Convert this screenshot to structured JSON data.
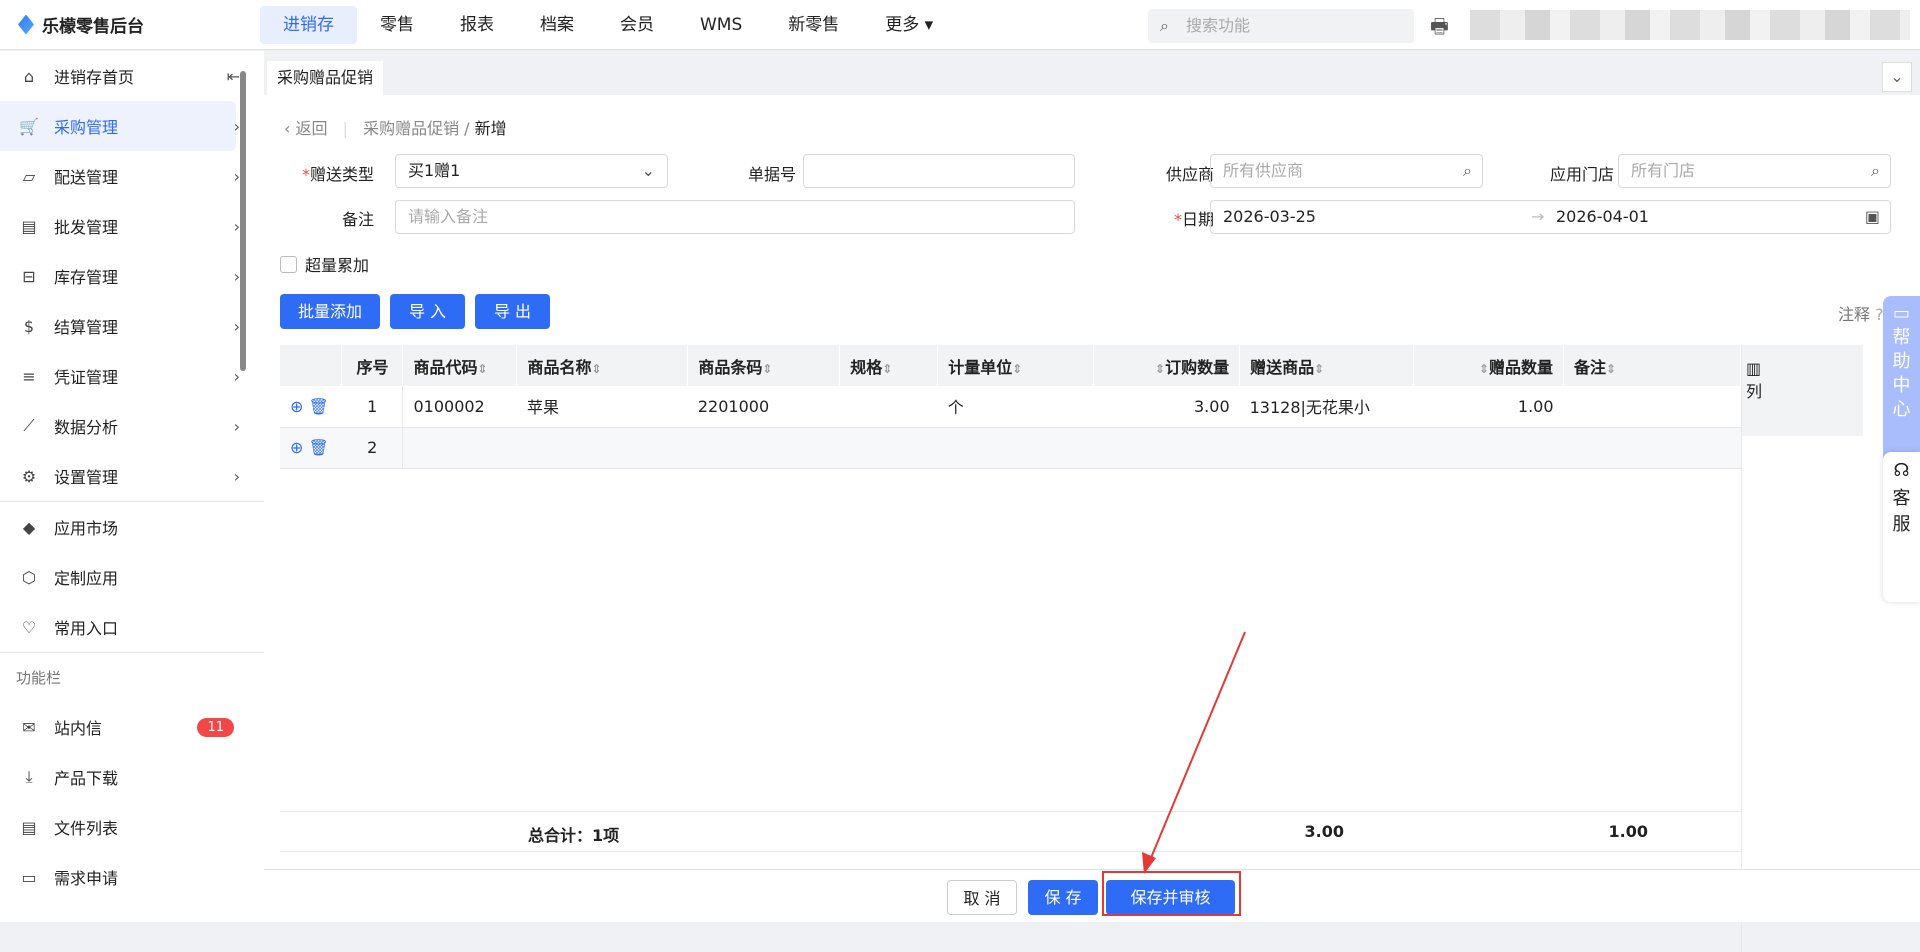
{
  "app": {
    "name": "乐檬零售后台",
    "top_nav": [
      "进销存",
      "零售",
      "报表",
      "档案",
      "会员",
      "WMS",
      "新零售",
      "更多"
    ],
    "active_nav": 0,
    "search_placeholder": "搜索功能"
  },
  "sidebar": {
    "items": [
      {
        "label": "进销存首页",
        "icon": "home-icon"
      },
      {
        "label": "采购管理",
        "icon": "cart-icon",
        "active": true
      },
      {
        "label": "配送管理",
        "icon": "box-icon"
      },
      {
        "label": "批发管理",
        "icon": "wallet-icon"
      },
      {
        "label": "库存管理",
        "icon": "inventory-icon"
      },
      {
        "label": "结算管理",
        "icon": "dollar-icon"
      },
      {
        "label": "凭证管理",
        "icon": "document-icon"
      },
      {
        "label": "数据分析",
        "icon": "chart-icon"
      },
      {
        "label": "设置管理",
        "icon": "settings-icon"
      }
    ],
    "apps": [
      {
        "label": "应用市场"
      },
      {
        "label": "定制应用"
      },
      {
        "label": "常用入口"
      }
    ],
    "section": "功能栏",
    "tools": [
      {
        "label": "站内信",
        "badge": "11"
      },
      {
        "label": "产品下载"
      },
      {
        "label": "文件列表"
      },
      {
        "label": "需求申请"
      }
    ]
  },
  "tab": {
    "label": "采购赠品促销"
  },
  "breadcrumb": {
    "back": "返回",
    "parent": "采购赠品促销",
    "current": "新增"
  },
  "form": {
    "gift_type_label": "赠送类型",
    "gift_type_value": "买1赠1",
    "doc_no_label": "单据号",
    "doc_no_value": "",
    "supplier_label": "供应商",
    "supplier_placeholder": "所有供应商",
    "store_label": "应用门店",
    "store_placeholder": "所有门店",
    "remark_label": "备注",
    "remark_placeholder": "请输入备注",
    "date_label": "日期",
    "date_start": "2026-03-25",
    "date_end": "2026-04-01",
    "overflow_label": "超量累加",
    "overflow_checked": false
  },
  "toolbar": {
    "batch_add": "批量添加",
    "import": "导 入",
    "export": "导 出",
    "note": "注释"
  },
  "table": {
    "columns": [
      "序号",
      "商品代码",
      "商品名称",
      "商品条码",
      "规格",
      "计量单位",
      "订购数量",
      "赠送商品",
      "赠品数量",
      "备注"
    ],
    "rows": [
      {
        "no": "1",
        "code": "0100002",
        "name": "苹果",
        "barcode": "2201000",
        "spec": "",
        "unit": "个",
        "qty": "3.00",
        "gift": "13128|无花果小",
        "gift_qty": "1.00",
        "remark": ""
      },
      {
        "no": "2",
        "code": "",
        "name": "",
        "barcode": "",
        "spec": "",
        "unit": "",
        "qty": "",
        "gift": "",
        "gift_qty": "",
        "remark": ""
      }
    ],
    "total_label": "总合计：1项",
    "total_qty": "3.00",
    "total_gift_qty": "1.00",
    "col_setting": "列"
  },
  "footer": {
    "cancel": "取 消",
    "save": "保 存",
    "save_audit": "保存并审核"
  },
  "float": {
    "help": "帮助中心",
    "service": "客服"
  },
  "colors": {
    "primary": "#2f6cf5",
    "badge": "#f04848",
    "highlight": "#e53935"
  }
}
